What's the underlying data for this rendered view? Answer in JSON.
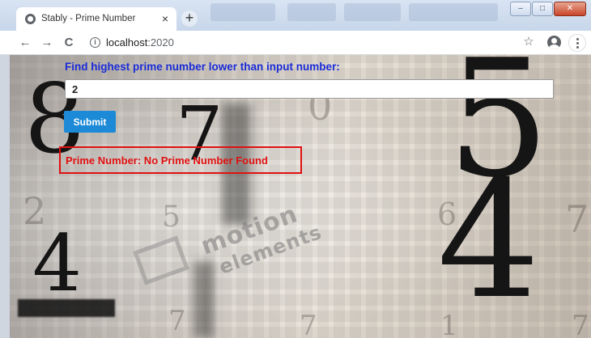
{
  "window": {
    "tab_title": "Stably - Prime Number",
    "tab_close": "×",
    "new_tab": "+",
    "minimize": "–",
    "maximize": "□",
    "close": "✕"
  },
  "toolbar": {
    "back": "←",
    "forward": "→",
    "reload": "C",
    "info": "i",
    "url_host": "localhost",
    "url_port": ":2020",
    "star": "☆"
  },
  "page": {
    "heading": "Find highest prime number lower than input number:",
    "input_value": "2",
    "submit_label": "Submit",
    "result_text": "Prime Number: No Prime Number Found"
  },
  "background": {
    "digits": [
      "8",
      "7",
      "0",
      "5",
      "4",
      "2",
      "5",
      "6",
      "7",
      "4",
      "7",
      "7",
      "1",
      "7"
    ],
    "watermark_line1": "motion",
    "watermark_line2": "elements"
  },
  "colors": {
    "heading": "#1a2bd6",
    "submit_bg": "#1c8ad6",
    "result": "#e01010"
  }
}
